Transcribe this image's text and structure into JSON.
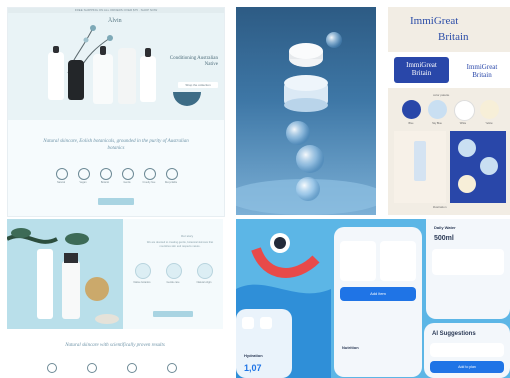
{
  "tile1": {
    "top_strip": "FREE SHIPPING ON ALL ORDERS OVER $75 · SHOP NOW",
    "brand": "Älvin",
    "hero_overlay": "Conditioning Australian Native",
    "hero_button": "Shop the collection",
    "body_text": "Natural skincare, Eolish botanicals, grounded in the purity of Australian botanics",
    "icons": [
      {
        "icon": "leaf-icon",
        "label": "Natural"
      },
      {
        "icon": "plant-icon",
        "label": "Vegan"
      },
      {
        "icon": "flower-icon",
        "label": "Botanic"
      },
      {
        "icon": "drop-icon",
        "label": "Gentle"
      },
      {
        "icon": "bunny-icon",
        "label": "Cruelty free"
      },
      {
        "icon": "recycle-icon",
        "label": "Recyclable"
      }
    ]
  },
  "tile3": {
    "title_line1": "ImmiGreat",
    "title_line2": "Britain",
    "logo_dark": [
      "ImmiGreat",
      "Britain"
    ],
    "logo_light": [
      "ImmiGreat",
      "Britain"
    ],
    "palette_label": "color palette",
    "swatches": [
      {
        "name": "Blue",
        "color": "#2947a9"
      },
      {
        "name": "Sky Blue",
        "color": "#c9dff2"
      },
      {
        "name": "White",
        "color": "#ffffff"
      },
      {
        "name": "Yellow",
        "color": "#f7efd8"
      }
    ],
    "bottom_label": "illustration"
  },
  "tile4": {
    "panel_title": "Our story",
    "panel_text": "We are devoted to creating gentle, botanical skincare that nourishes skin and respects nature.",
    "rounds": [
      "Native botanics",
      "Gentle care",
      "Natural origin"
    ],
    "footer_text": "Natural skincare with scientifically proven results"
  },
  "tile5": {
    "phones": [
      {
        "title": "Hydration",
        "value": "1,07"
      },
      {
        "title": "Nutrition",
        "value": "Add item"
      },
      {
        "title": "Daily Water",
        "value": "500ml"
      },
      {
        "title": "AI Suggestions",
        "value": "Add to plan"
      }
    ]
  }
}
